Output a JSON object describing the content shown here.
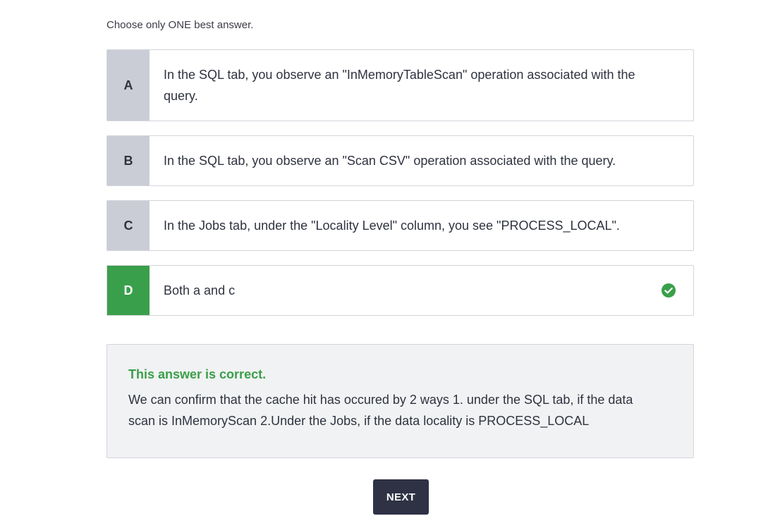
{
  "instruction": "Choose only ONE best answer.",
  "options": [
    {
      "letter": "A",
      "text": "In the SQL tab, you observe an \"InMemoryTableScan\" operation associated with the query."
    },
    {
      "letter": "B",
      "text": "In the SQL tab, you observe an \"Scan CSV\" operation associated with the query."
    },
    {
      "letter": "C",
      "text": "In the Jobs tab, under the \"Locality Level\" column, you see \"PROCESS_LOCAL\"."
    },
    {
      "letter": "D",
      "text": "Both a and c"
    }
  ],
  "explanation": {
    "title": "This answer is correct.",
    "body": "We can confirm that the cache hit has occured by 2 ways 1. under the SQL tab, if the data scan is InMemoryScan 2.Under the Jobs, if the data locality is PROCESS_LOCAL"
  },
  "next_label": "NEXT",
  "colors": {
    "correct_green": "#3a9f4a",
    "letter_gray": "#cbcdd6",
    "button_dark": "#2e3244"
  },
  "icons": {
    "correct_indicator": "check-circle-icon"
  }
}
